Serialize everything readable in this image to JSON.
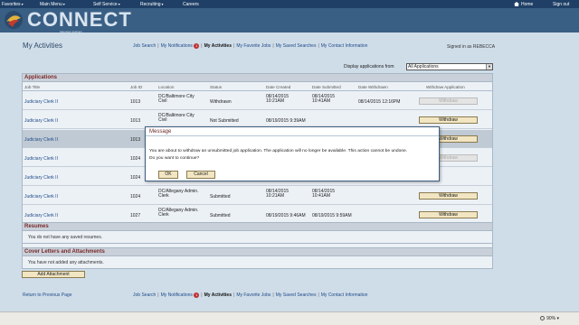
{
  "topnav": {
    "favorites": "Favorites",
    "main_menu": "Main Menu",
    "self_service": "Self Service",
    "recruiting": "Recruiting",
    "careers": "Careers",
    "home": "Home",
    "sign_out": "Sign out"
  },
  "banner": {
    "logo_text": "CONNECT",
    "logo_subtitle": "Maryland Judiciary"
  },
  "page": {
    "title": "My Activities",
    "signed_in": "Signed in as REBECCA",
    "display_label": "Display applications from",
    "display_value": "All Applications"
  },
  "links": {
    "job_search": "Job Search",
    "notifications": "My Notifications",
    "notifications_count": "1",
    "activities": "My Activities",
    "favorite_jobs": "My Favorite Jobs",
    "saved_searches": "My Saved Searches",
    "contact_info": "My Contact Information"
  },
  "applications": {
    "header": "Applications",
    "columns": [
      "Job Title",
      "Job ID",
      "Location",
      "Status",
      "Date Created",
      "Date Submitted",
      "Date Withdrawn",
      "Withdraw Application"
    ],
    "rows": [
      {
        "title": "Judiciary Clerk II",
        "id": "1013",
        "location": "DC/Baltimore City Civil",
        "status": "Withdrawn",
        "created": "08/14/2015 10:21AM",
        "submitted": "08/14/2015 10:41AM",
        "withdrawn": "08/14/2015 12:16PM",
        "action": "Withdraw",
        "action_disabled": true
      },
      {
        "title": "Judiciary Clerk II",
        "id": "1013",
        "location": "DC/Baltimore City Civil",
        "status": "Not Submitted",
        "created": "08/19/2015 9:39AM",
        "submitted": "",
        "withdrawn": "",
        "action": "Withdraw",
        "action_disabled": false
      },
      {
        "title": "Judiciary Clerk II",
        "id": "1013",
        "location": "",
        "status": "",
        "created": "",
        "submitted": "",
        "withdrawn": "",
        "action": "Withdraw",
        "action_disabled": false
      },
      {
        "title": "Judiciary Clerk II",
        "id": "1024",
        "location": "",
        "status": "",
        "created": "",
        "submitted": "",
        "withdrawn": "",
        "action": "Withdraw",
        "action_disabled": true
      },
      {
        "title": "Judiciary Clerk II",
        "id": "1024",
        "location": "",
        "status": "",
        "created": "",
        "submitted": "",
        "withdrawn": "",
        "action": "",
        "action_disabled": false
      },
      {
        "title": "Judiciary Clerk II",
        "id": "1024",
        "location": "DC/Allegany Admin. Clerk",
        "status": "Submitted",
        "created": "08/14/2015 10:21AM",
        "submitted": "08/14/2015 10:41AM",
        "withdrawn": "",
        "action": "Withdraw",
        "action_disabled": false
      },
      {
        "title": "Judiciary Clerk II",
        "id": "1027",
        "location": "DC/Allegany Admin. Clerk",
        "status": "Submitted",
        "created": "08/19/2015 9:46AM",
        "submitted": "08/19/2015 9:59AM",
        "withdrawn": "",
        "action": "Withdraw",
        "action_disabled": false
      }
    ]
  },
  "resumes": {
    "header": "Resumes",
    "empty_text": "You do not have any saved resumes."
  },
  "cover_letters": {
    "header": "Cover Letters and Attachments",
    "empty_text": "You have not added any attachments.",
    "add_button": "Add Attachment"
  },
  "footer": {
    "return_link": "Return to Previous Page"
  },
  "statusbar": {
    "zoom": "90%"
  },
  "dialog": {
    "title": "Message",
    "line1": "You are about to withdraw an unsubmitted job application. The application will no longer be available. This action cannot be undone.",
    "line2": "Do you want to continue?",
    "ok": "OK",
    "cancel": "Cancel"
  },
  "colors": {
    "nav": "#1f3f66",
    "banner": "#3a5f85",
    "button": "#f2e6c2",
    "header_text": "#7a2a2a"
  }
}
